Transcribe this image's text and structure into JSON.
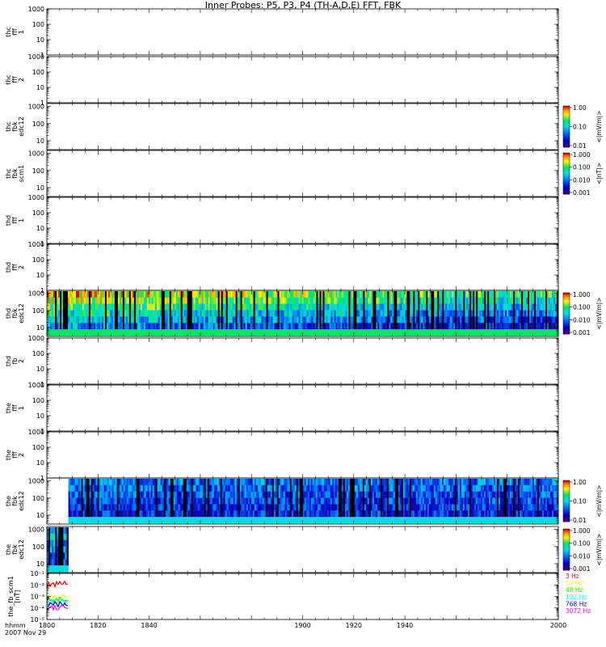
{
  "title": "Inner Probes: P5, P3, P4 (TH-A,D,E) FFT, FBK",
  "date_label": "2007 Nov 29",
  "time_label": "hhmm",
  "chart_data": {
    "type": "heatmap",
    "xlim": [
      1800,
      2000
    ],
    "x_ticks": [
      "1800",
      "1820",
      "1840",
      "1860",
      "1880",
      "1900",
      "1920",
      "1940",
      "1960",
      "1980",
      "2000"
    ],
    "x_tick_labels": [
      "1800",
      "1820",
      "1840",
      "1900",
      "1920",
      "1940",
      "2000"
    ],
    "panels": [
      {
        "ylabel": [
          "thc",
          "fff",
          "1"
        ],
        "ylim": [
          1,
          1000
        ],
        "yticks": [
          "1000",
          "100",
          "10",
          "1"
        ],
        "data": "empty"
      },
      {
        "ylabel": [
          "thc",
          "fff",
          "2"
        ],
        "ylim": [
          1,
          1000
        ],
        "yticks": [
          "1000",
          "100",
          "10",
          "1"
        ],
        "data": "empty"
      },
      {
        "ylabel": [
          "thc",
          "fbk",
          "edc12"
        ],
        "ylim": [
          3,
          1500
        ],
        "yticks": [
          "1000",
          "100",
          "10"
        ],
        "data": "empty",
        "colorbar": {
          "ticks": [
            "1.00",
            "0.10",
            "0.01"
          ],
          "label": "<|mV/m|>"
        }
      },
      {
        "ylabel": [
          "thc",
          "fbk",
          "scm1"
        ],
        "ylim": [
          3,
          1500
        ],
        "yticks": [
          "1000",
          "100",
          "10"
        ],
        "data": "empty",
        "colorbar": {
          "ticks": [
            "1.000",
            "0.100",
            "0.010",
            "0.001"
          ],
          "label": "<|nT|>"
        }
      },
      {
        "ylabel": [
          "thd",
          "fff",
          "1"
        ],
        "ylim": [
          1,
          1000
        ],
        "yticks": [
          "1000",
          "100",
          "10",
          "1"
        ],
        "data": "empty"
      },
      {
        "ylabel": [
          "thd",
          "fff",
          "2"
        ],
        "ylim": [
          1,
          1000
        ],
        "yticks": [
          "1000",
          "100",
          "10",
          "1"
        ],
        "data": "empty"
      },
      {
        "ylabel": [
          "thd",
          "fbk",
          "edc12"
        ],
        "ylim": [
          3,
          1500
        ],
        "yticks": [
          "1000",
          "100",
          "10"
        ],
        "data": "spectrogram",
        "x_range": [
          1800,
          2000
        ],
        "colorbar": {
          "ticks": [
            "1.000",
            "0.100",
            "0.010",
            "0.001"
          ],
          "label": "<|mV/m|>"
        }
      },
      {
        "ylabel": [
          "thd",
          "fb",
          "2"
        ],
        "ylim": [
          1,
          1000
        ],
        "yticks": [
          "1000",
          "100",
          "10",
          "1"
        ],
        "data": "empty"
      },
      {
        "ylabel": [
          "the",
          "fff",
          "1"
        ],
        "ylim": [
          1,
          1000
        ],
        "yticks": [
          "1000",
          "100",
          "10",
          "1"
        ],
        "data": "empty"
      },
      {
        "ylabel": [
          "the",
          "fff",
          "2"
        ],
        "ylim": [
          1,
          1000
        ],
        "yticks": [
          "1000",
          "100",
          "10",
          "1"
        ],
        "data": "empty"
      },
      {
        "ylabel": [
          "the",
          "fbk",
          "edc12"
        ],
        "ylim": [
          3,
          1500
        ],
        "yticks": [
          "1000",
          "100",
          "10"
        ],
        "data": "spectrogram",
        "x_range": [
          1808.4,
          2000
        ],
        "colorbar": {
          "ticks": [
            "1.00",
            "0.10",
            "0.01"
          ],
          "label": "<|mV/m|>"
        }
      },
      {
        "ylabel": [
          "the",
          "fbk",
          "edc12"
        ],
        "ylim": [
          3,
          1500
        ],
        "yticks": [
          "1000",
          "100",
          "10"
        ],
        "data": "spectrogram",
        "x_range": [
          1800,
          1808.4
        ],
        "colorbar": {
          "ticks": [
            "1.000",
            "0.100",
            "0.010",
            "0.001"
          ],
          "label": "<|mV/m|>"
        }
      },
      {
        "ylabel": [
          "the_fb_scm1",
          "[nT]"
        ],
        "ylim": [
          1e-05,
          0.1
        ],
        "yticks": [
          "10⁻¹",
          "10⁻²",
          "10⁻³",
          "10⁻⁴",
          "10⁻⁵"
        ],
        "data": "lines",
        "x_range": [
          1800,
          1808.4
        ],
        "legend": [
          {
            "label": "3 Hz",
            "color": "#ff0000"
          },
          {
            "label": "12 Hz",
            "color": "#ffff00"
          },
          {
            "label": "48 Hz",
            "color": "#00ff00"
          },
          {
            "label": "192 Hz",
            "color": "#00ffff"
          },
          {
            "label": "768 Hz",
            "color": "#0000ff"
          },
          {
            "label": "3072 Hz",
            "color": "#ff00ff"
          }
        ]
      }
    ]
  }
}
